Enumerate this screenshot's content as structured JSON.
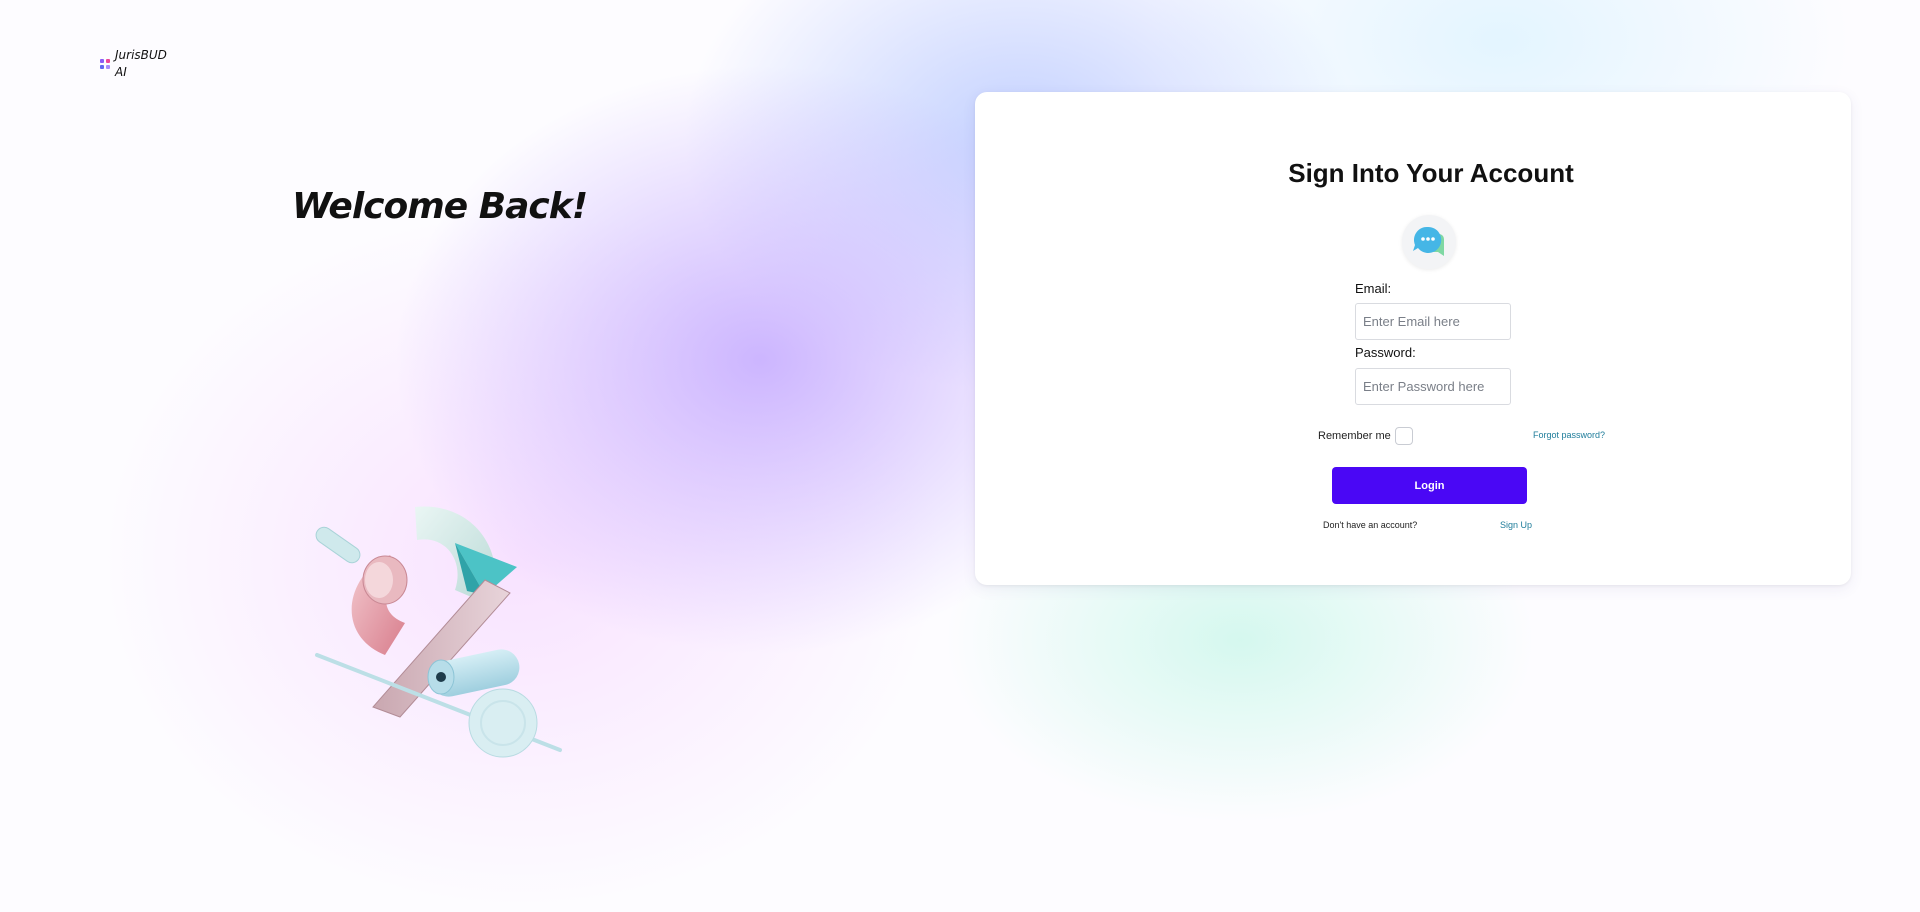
{
  "brand": {
    "name_line1": "JurisBUD",
    "name_line2": "AI",
    "mark_colors": [
      "#8b5cf6",
      "#ec4899",
      "#6366f1",
      "#a78bfa"
    ]
  },
  "hero": {
    "heading": "Welcome Back!",
    "illustration_icon": "abstract-3d-shapes-illustration"
  },
  "login_card": {
    "title": "Sign Into Your Account",
    "badge_icon": "chat-bubbles-icon",
    "email": {
      "label": "Email:",
      "placeholder": "Enter Email here",
      "value": ""
    },
    "password": {
      "label": "Password:",
      "placeholder": "Enter Password here",
      "value": ""
    },
    "remember_label": "Remember me",
    "remember_checked": false,
    "forgot_label": "Forgot password?",
    "login_label": "Login",
    "no_account_text": "Don't have an account?",
    "signup_label": "Sign Up"
  },
  "colors": {
    "primary_button": "#4a07f5",
    "link": "#1e7c9a"
  }
}
